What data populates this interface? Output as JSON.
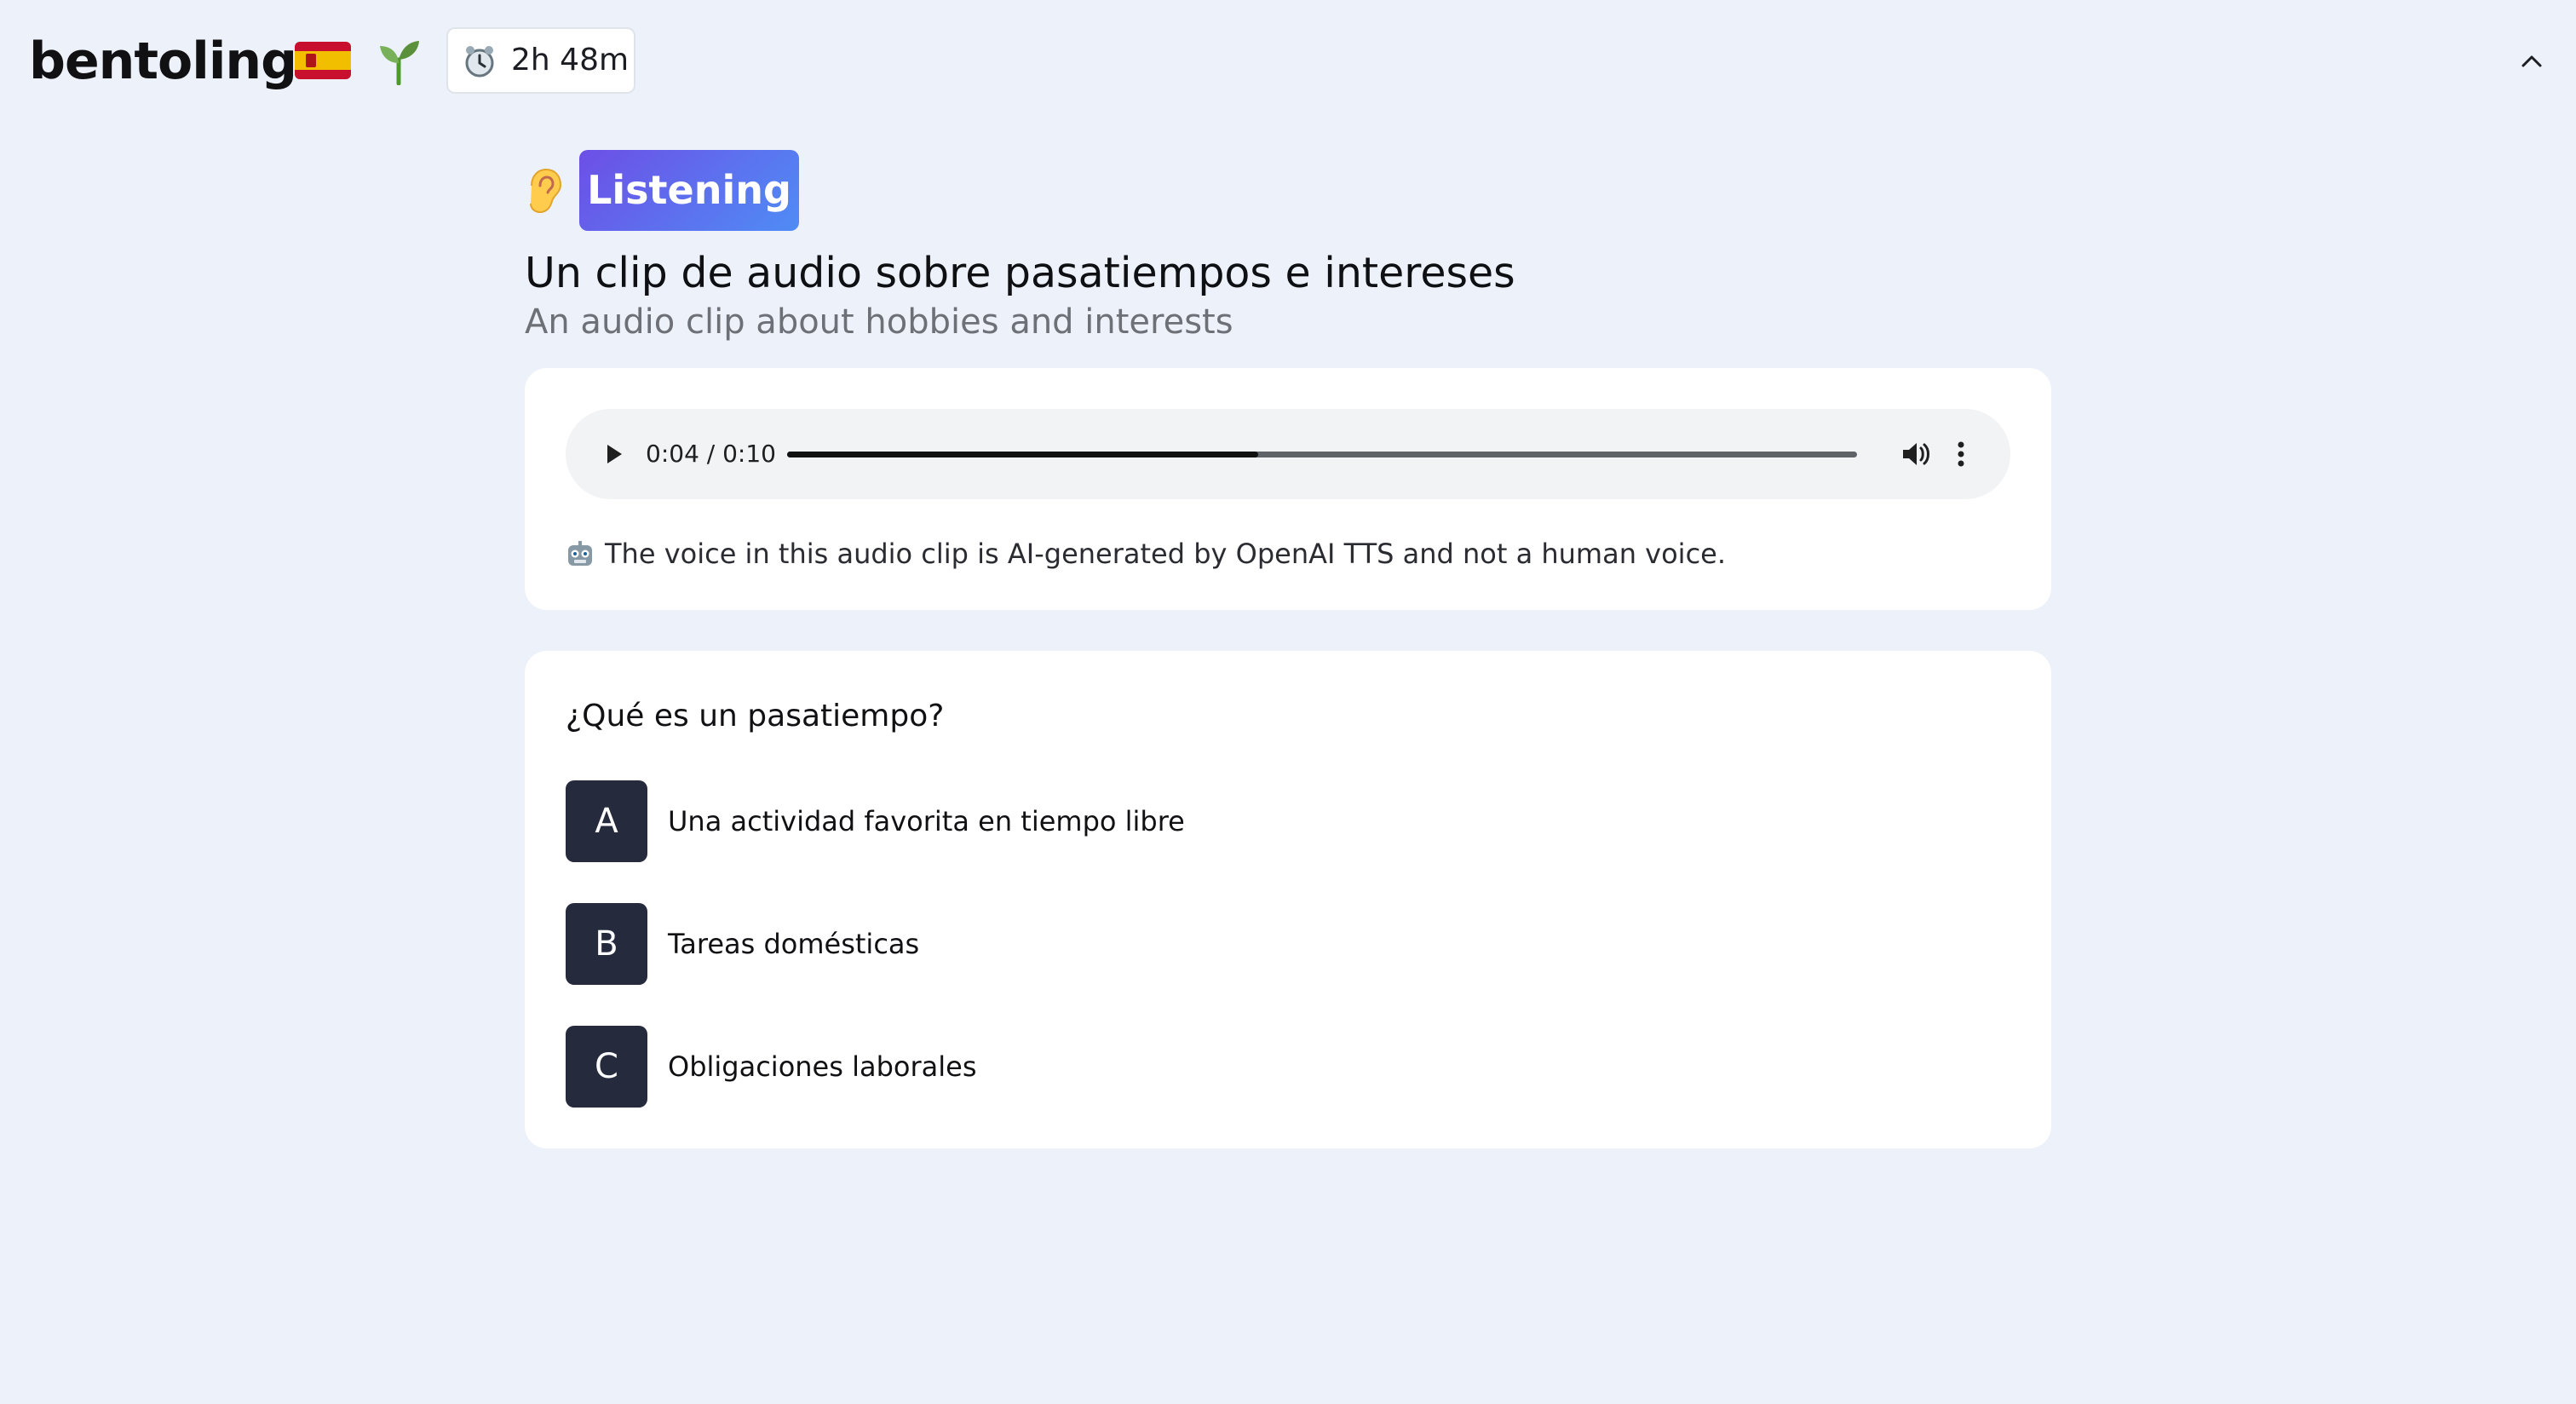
{
  "header": {
    "logo": "bentolingo",
    "flag_icon": "spain-flag-icon",
    "level_icon": "sprout-icon",
    "timer_icon": "alarm-clock-icon",
    "timer_text": "2h 48m",
    "collapse_icon": "chevron-up-icon"
  },
  "lesson": {
    "skill_icon": "ear-icon",
    "skill_badge": "Listening",
    "title_es": "Un clip de audio sobre pasatiempos e intereses",
    "title_en": "An audio clip about hobbies and interests"
  },
  "audio": {
    "time_label": "0:04 / 0:10",
    "current_seconds": 4,
    "duration_seconds": 10,
    "progress_fraction": 0.44,
    "play_icon": "play-icon",
    "volume_icon": "volume-icon",
    "more_icon": "more-options-icon",
    "disclaimer_icon": "robot-icon",
    "disclaimer": "The voice in this audio clip is AI-generated by OpenAI TTS and not a human voice."
  },
  "quiz": {
    "question": "¿Qué es un pasatiempo?",
    "options": [
      {
        "letter": "A",
        "text": "Una actividad favorita en tiempo libre"
      },
      {
        "letter": "B",
        "text": "Tareas domésticas"
      },
      {
        "letter": "C",
        "text": "Obligaciones laborales"
      }
    ]
  },
  "colors": {
    "page_background": "#edf1f9",
    "badge_gradient_start": "#6d4fe6",
    "badge_gradient_end": "#4f8cf5",
    "option_letter_background": "#262a3d"
  }
}
